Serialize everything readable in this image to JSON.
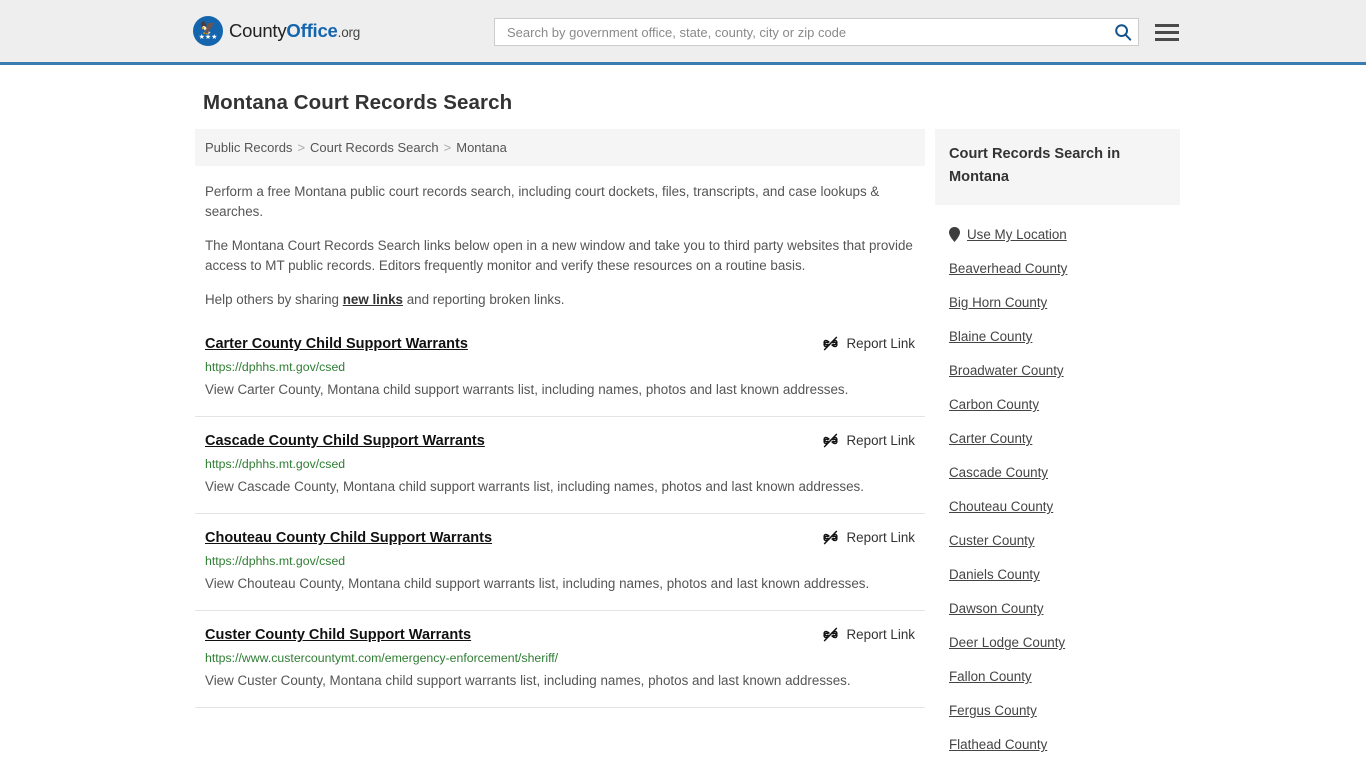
{
  "header": {
    "logo": {
      "part1": "County",
      "part2": "Office",
      "part3": ".org",
      "icon": "eagle-seal-icon"
    },
    "search": {
      "placeholder": "Search by government office, state, county, city or zip code",
      "value": "",
      "icon": "search-icon"
    },
    "menu_icon": "hamburger-menu-icon",
    "accent_color": "#3a7cb0"
  },
  "page": {
    "title": "Montana Court Records Search"
  },
  "breadcrumb": {
    "items": [
      "Public Records",
      "Court Records Search",
      "Montana"
    ],
    "separator": ">"
  },
  "intro": {
    "p1": "Perform a free Montana public court records search, including court dockets, files, transcripts, and case lookups & searches.",
    "p2": "The Montana Court Records Search links below open in a new window and take you to third party websites that provide access to MT public records. Editors frequently monitor and verify these resources on a routine basis.",
    "p3_before": "Help others by sharing ",
    "p3_link": "new links",
    "p3_after": " and reporting broken links."
  },
  "results": {
    "report_label": "Report Link",
    "report_icon": "broken-link-icon",
    "items": [
      {
        "title": "Carter County Child Support Warrants",
        "url": "https://dphhs.mt.gov/csed",
        "description": "View Carter County, Montana child support warrants list, including names, photos and last known addresses."
      },
      {
        "title": "Cascade County Child Support Warrants",
        "url": "https://dphhs.mt.gov/csed",
        "description": "View Cascade County, Montana child support warrants list, including names, photos and last known addresses."
      },
      {
        "title": "Chouteau County Child Support Warrants",
        "url": "https://dphhs.mt.gov/csed",
        "description": "View Chouteau County, Montana child support warrants list, including names, photos and last known addresses."
      },
      {
        "title": "Custer County Child Support Warrants",
        "url": "https://www.custercountymt.com/emergency-enforcement/sheriff/",
        "description": "View Custer County, Montana child support warrants list, including names, photos and last known addresses."
      }
    ]
  },
  "sidebar": {
    "heading": "Court Records Search in Montana",
    "location_item": {
      "label": "Use My Location",
      "icon": "map-pin-icon"
    },
    "counties": [
      "Beaverhead County",
      "Big Horn County",
      "Blaine County",
      "Broadwater County",
      "Carbon County",
      "Carter County",
      "Cascade County",
      "Chouteau County",
      "Custer County",
      "Daniels County",
      "Dawson County",
      "Deer Lodge County",
      "Fallon County",
      "Fergus County",
      "Flathead County"
    ]
  }
}
